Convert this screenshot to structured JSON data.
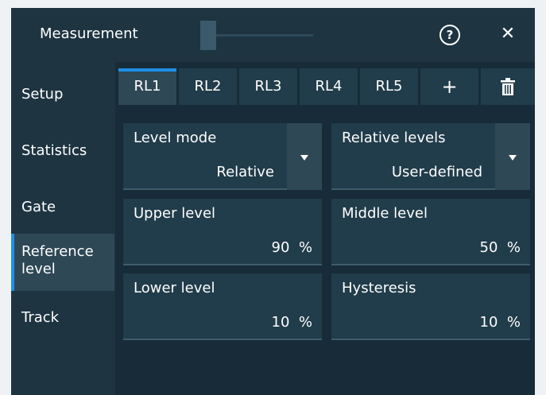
{
  "dialog": {
    "title": "Measurement",
    "help_label": "?",
    "close_label": "✕"
  },
  "sidebar": {
    "items": [
      {
        "label": "Setup"
      },
      {
        "label": "Statistics"
      },
      {
        "label": "Gate"
      },
      {
        "label": "Reference level",
        "active": true
      },
      {
        "label": "Track"
      }
    ]
  },
  "tabs": [
    {
      "label": "RL1",
      "active": true
    },
    {
      "label": "RL2"
    },
    {
      "label": "RL3"
    },
    {
      "label": "RL4"
    },
    {
      "label": "RL5"
    },
    {
      "label": "+",
      "icon": "plus-icon"
    },
    {
      "label": "",
      "icon": "trash-icon"
    }
  ],
  "fields": {
    "level_mode": {
      "label": "Level mode",
      "value": "Relative"
    },
    "relative_levels": {
      "label": "Relative levels",
      "value": "User-defined"
    },
    "upper_level": {
      "label": "Upper level",
      "value": "90",
      "unit": "%"
    },
    "middle_level": {
      "label": "Middle level",
      "value": "50",
      "unit": "%"
    },
    "lower_level": {
      "label": "Lower level",
      "value": "10",
      "unit": "%"
    },
    "hysteresis": {
      "label": "Hysteresis",
      "value": "10",
      "unit": "%"
    }
  },
  "colors": {
    "accent": "#1e90e8",
    "panel": "#1e3441",
    "content_bg": "#172c38",
    "field_bg": "#213c4a"
  }
}
